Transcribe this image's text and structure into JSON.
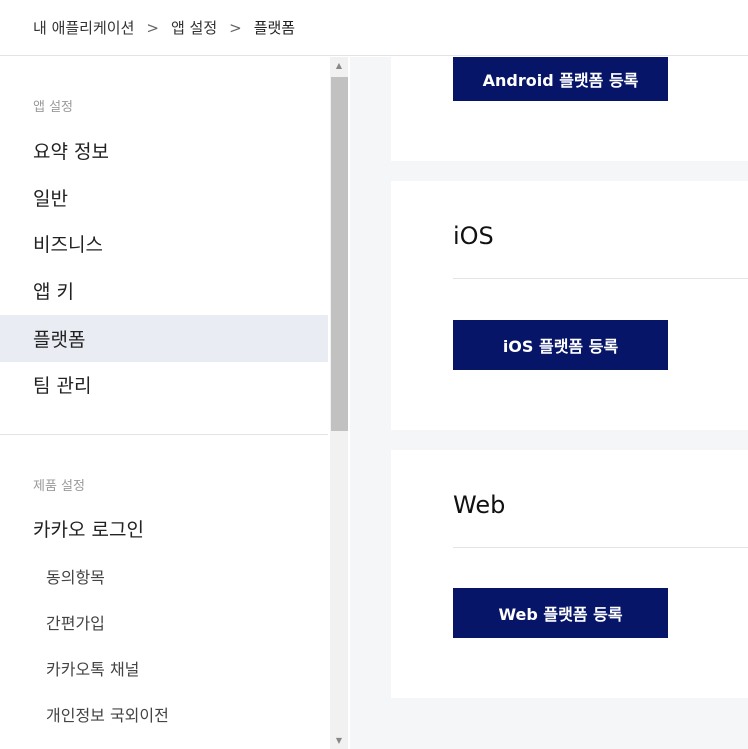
{
  "breadcrumb": {
    "items": [
      "내 애플리케이션",
      "앱 설정",
      "플랫폼"
    ],
    "separator": ">"
  },
  "sidebar": {
    "app_section_label": "앱 설정",
    "app_items": [
      {
        "label": "요약 정보",
        "active": false
      },
      {
        "label": "일반",
        "active": false
      },
      {
        "label": "비즈니스",
        "active": false
      },
      {
        "label": "앱 키",
        "active": false
      },
      {
        "label": "플랫폼",
        "active": true
      },
      {
        "label": "팀 관리",
        "active": false
      }
    ],
    "product_section_label": "제품 설정",
    "product_items": [
      {
        "label": "카카오 로그인"
      }
    ],
    "product_sub_items": [
      {
        "label": "동의항목"
      },
      {
        "label": "간편가입"
      },
      {
        "label": "카카오톡 채널"
      },
      {
        "label": "개인정보 국외이전"
      }
    ]
  },
  "main": {
    "android": {
      "button_label": "Android 플랫폼 등록"
    },
    "ios": {
      "title": "iOS",
      "button_label": "iOS 플랫폼 등록"
    },
    "web": {
      "title": "Web",
      "button_label": "Web 플랫폼 등록"
    }
  },
  "colors": {
    "primary_button": "#061567",
    "active_nav_bg": "#e9ecf3",
    "page_bg": "#f5f6f7"
  }
}
